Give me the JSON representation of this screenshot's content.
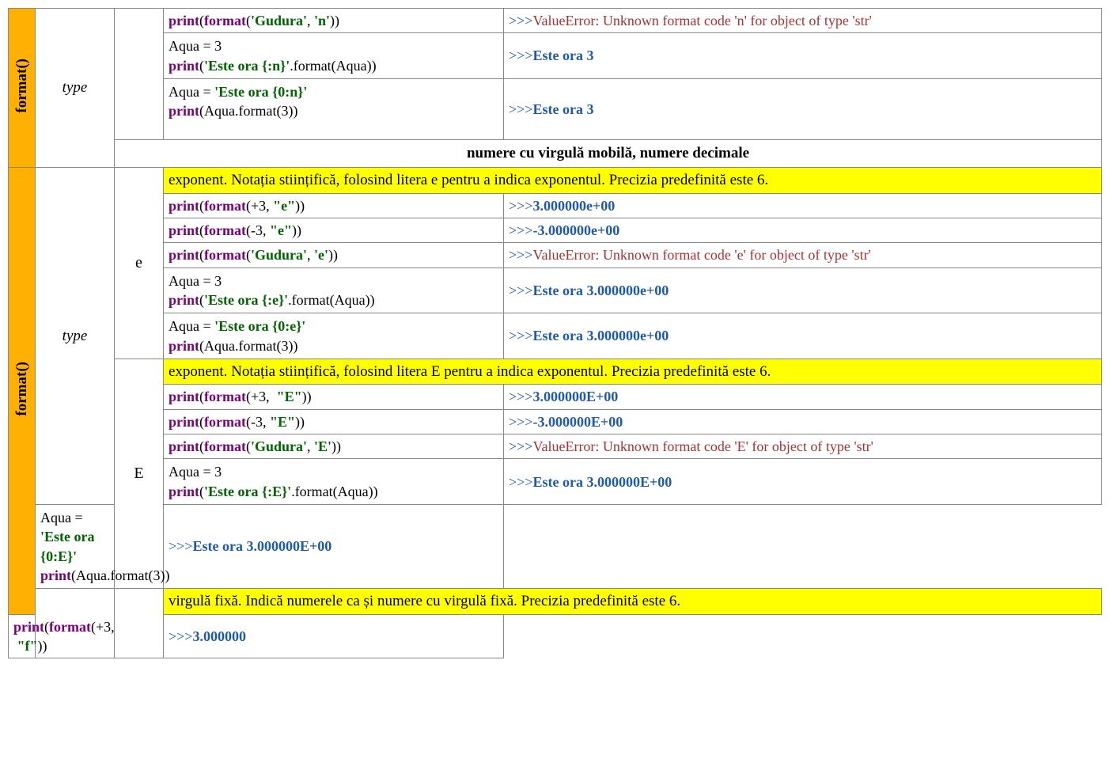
{
  "sidebar": {
    "label_top": "format()",
    "label_bottom": "format()"
  },
  "type_label_top": "type",
  "type_label_bottom": "type",
  "specs": {
    "e_low": "e",
    "e_up": "E"
  },
  "section_header": "numere cu virgulă mobilă, numere decimale",
  "desc": {
    "e_low": "exponent. Notația stiințifică, folosind litera e pentru a indica exponentul. Precizia predefinită este 6.",
    "e_up": "exponent. Notația stiințifică, folosind litera E pentru a indica exponentul. Precizia predefinită este 6.",
    "f": "virgulă fixă. Indică numerele ca și numere cu virgulă fixă. Precizia predefinită este 6."
  },
  "prompt": ">>>",
  "out": {
    "n_err": "ValueError: Unknown format code 'n' for object of type 'str'",
    "n_ora": "Este ora 3",
    "e_pos": "3.000000e+00",
    "e_neg": "-3.000000e+00",
    "e_err": "ValueError: Unknown format code 'e' for object of type 'str'",
    "e_ora": "Este ora 3.000000e+00",
    "E_pos": "3.000000E+00",
    "E_neg": "-3.000000E+00",
    "E_err": "ValueError: Unknown format code 'E' for object of type 'str'",
    "E_ora": "Este ora 3.000000E+00",
    "f_pos": "3.000000"
  },
  "tok": {
    "print": "print",
    "format": "format",
    "lp": "(",
    "rp": ")",
    "comma": ", ",
    "dot": ".",
    "gudura": "'Gudura'",
    "sq_n": "'n'",
    "sq_e": "'e'",
    "sq_E": "'E'",
    "dq_e": "\"e\"",
    "dq_E": "\"E\"",
    "dq_f": "\"f\"",
    "plus3": "+3",
    "minus3": "-3",
    "three": "3",
    "aqua_assign": "Aqua = 3",
    "aqua_assign_pref": "Aqua = ",
    "aqua_var": "Aqua",
    "este_n": "'Este ora {:n}'",
    "este_0n": "'Este ora {0:n}'",
    "este_e": "'Este ora {:e}'",
    "este_0e": "'Este ora {0:e}'",
    "este_E": "'Este ora {:E}'",
    "este_0E": "'Este ora {0:E}'",
    "format_aqua": ".format(Aqua))",
    "format_3": ".format(3))"
  }
}
